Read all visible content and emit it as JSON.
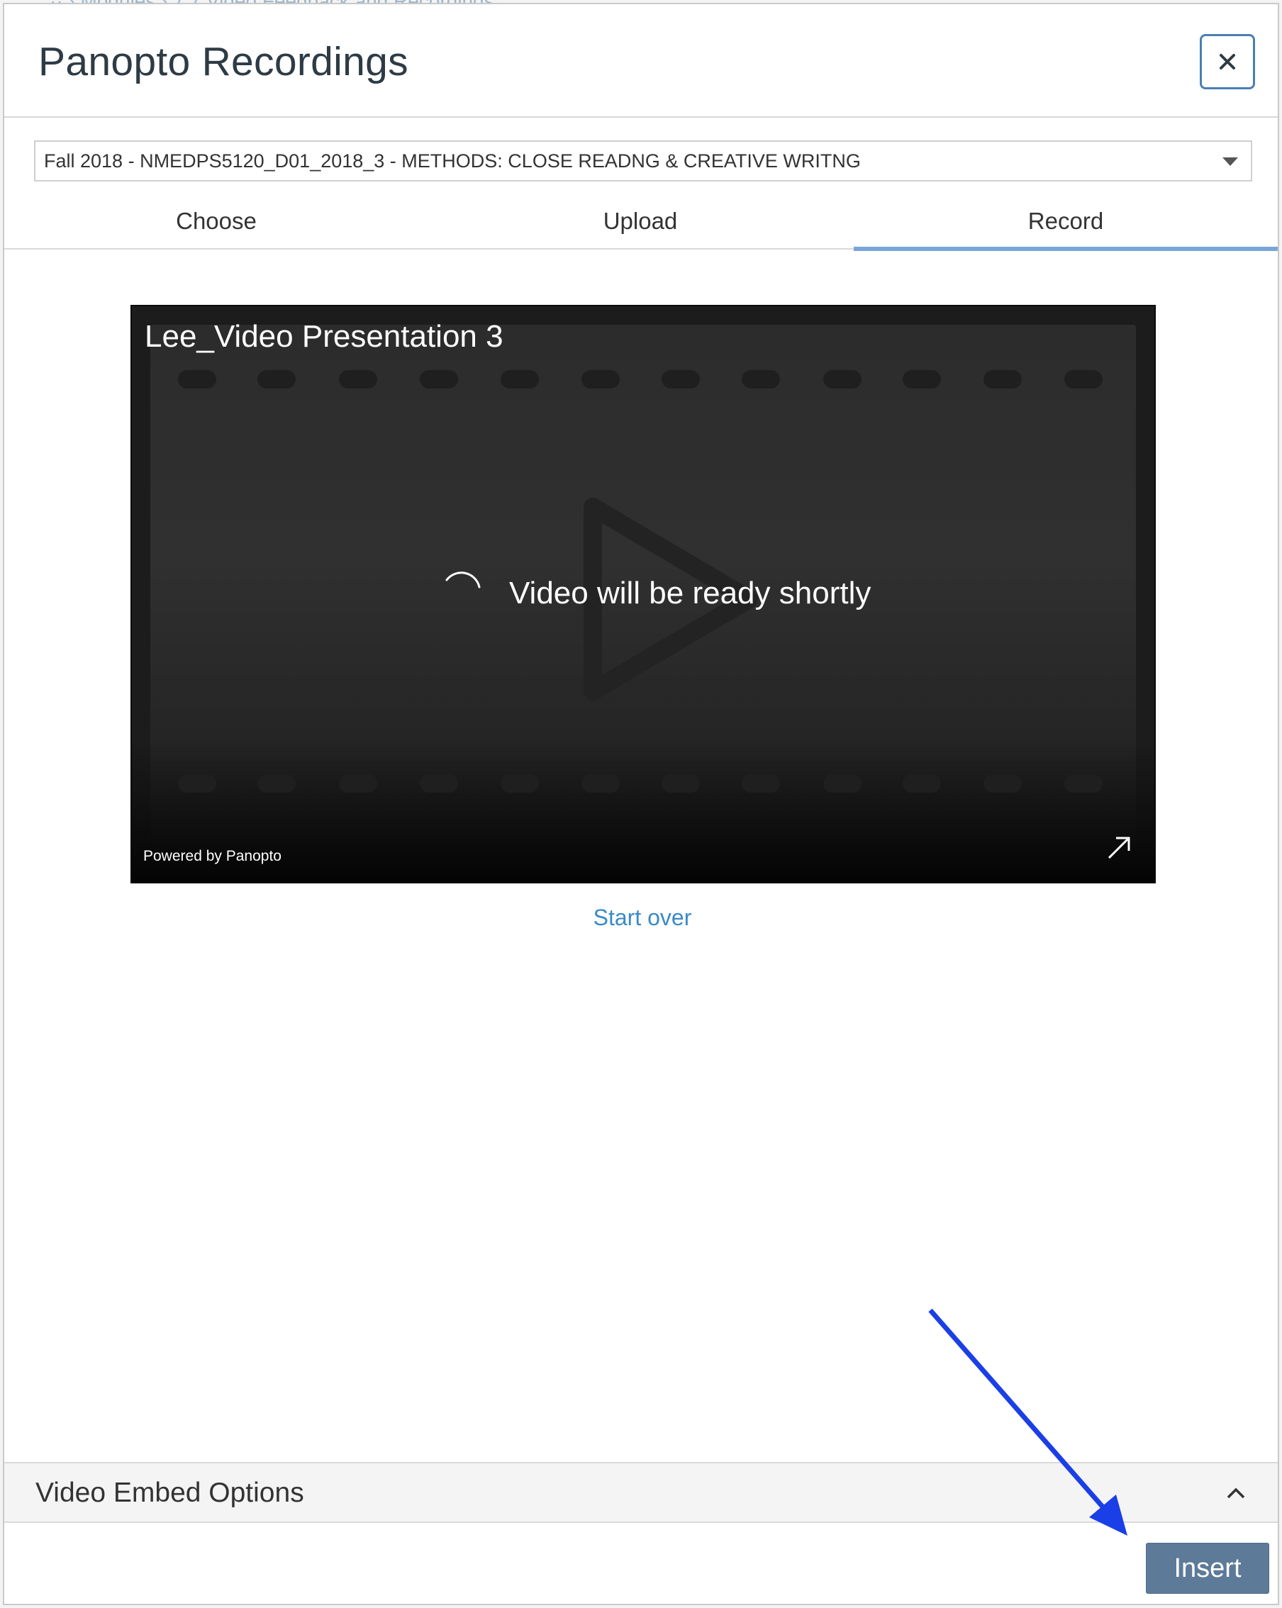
{
  "dialog": {
    "title": "Panopto Recordings",
    "close_icon": "close-icon"
  },
  "course_select": {
    "selected": "Fall 2018 - NMEDPS5120_D01_2018_3 - METHODS: CLOSE READNG & CREATIVE WRITNG"
  },
  "tabs": [
    {
      "label": "Choose",
      "active": false
    },
    {
      "label": "Upload",
      "active": false
    },
    {
      "label": "Record",
      "active": true
    }
  ],
  "player": {
    "title": "Lee_Video Presentation 3",
    "status": "Video will be ready shortly",
    "powered_by": "Powered by Panopto"
  },
  "start_over": "Start over",
  "embed_options": {
    "label": "Video Embed Options"
  },
  "insert_button": "Insert",
  "colors": {
    "accent": "#7aa5d8",
    "link": "#3a8bc5",
    "insert_bg": "#5d7a99",
    "annotation_arrow": "#1b3fe6"
  }
}
